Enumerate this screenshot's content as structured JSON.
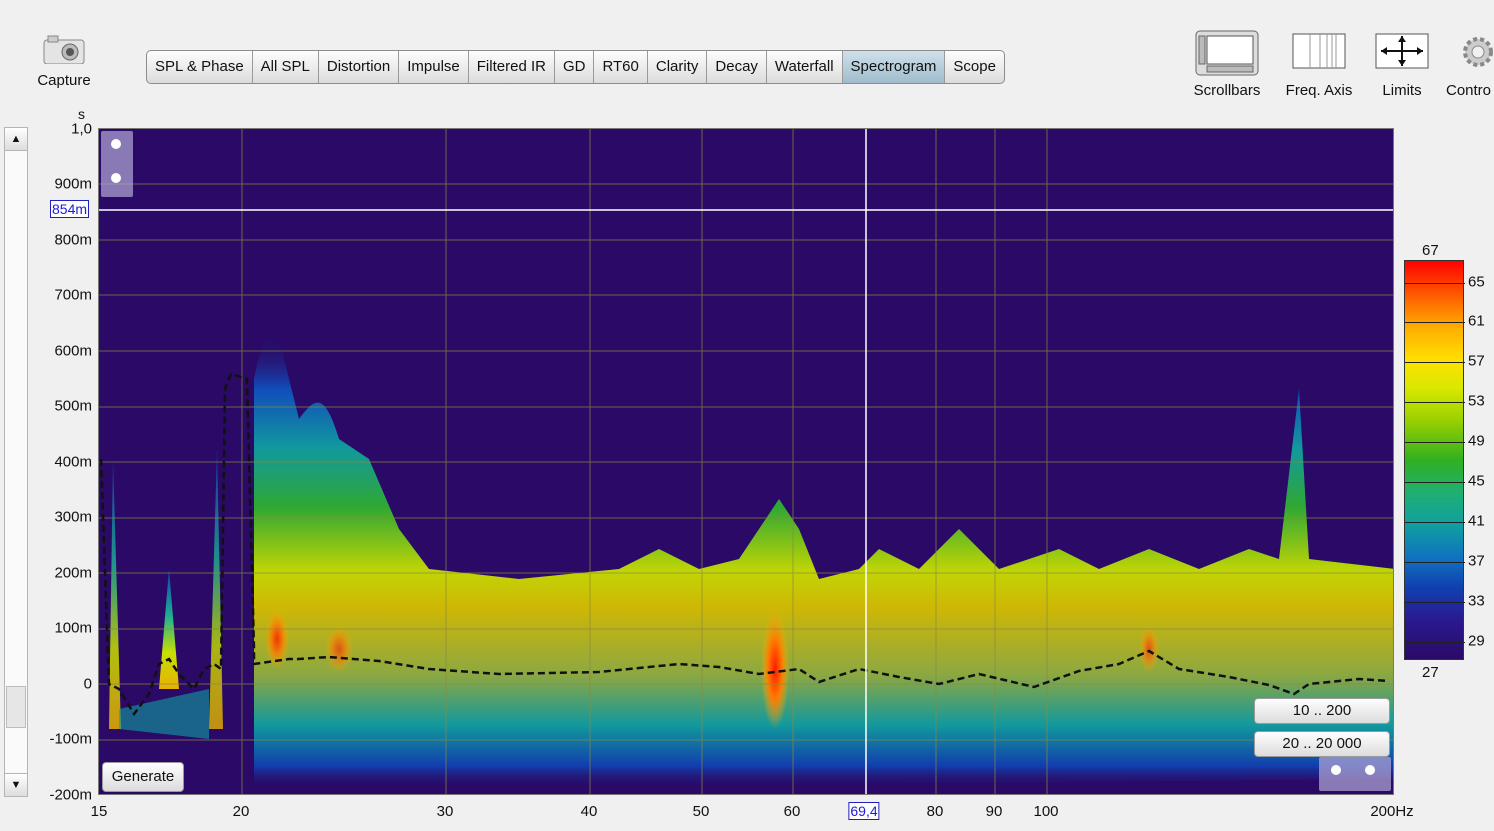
{
  "capture": {
    "label": "Capture"
  },
  "tabs": [
    {
      "label": "SPL & Phase",
      "active": false
    },
    {
      "label": "All SPL",
      "active": false
    },
    {
      "label": "Distortion",
      "active": false
    },
    {
      "label": "Impulse",
      "active": false
    },
    {
      "label": "Filtered IR",
      "active": false
    },
    {
      "label": "GD",
      "active": false
    },
    {
      "label": "RT60",
      "active": false
    },
    {
      "label": "Clarity",
      "active": false
    },
    {
      "label": "Decay",
      "active": false
    },
    {
      "label": "Waterfall",
      "active": false
    },
    {
      "label": "Spectrogram",
      "active": true
    },
    {
      "label": "Scope",
      "active": false
    }
  ],
  "toolbar": {
    "scrollbars": "Scrollbars",
    "freq_axis": "Freq. Axis",
    "limits": "Limits",
    "controls": "Contro"
  },
  "y_axis": {
    "unit": "s",
    "ticks": [
      "1,0",
      "900m",
      "800m",
      "700m",
      "600m",
      "500m",
      "400m",
      "300m",
      "200m",
      "100m",
      "0",
      "-100m",
      "-200m"
    ],
    "cursor_label": "854m"
  },
  "x_axis": {
    "ticks": [
      "15",
      "20",
      "30",
      "40",
      "50",
      "60",
      "80",
      "90",
      "100",
      "200Hz"
    ],
    "cursor_label": "69,4"
  },
  "buttons": {
    "generate": "Generate",
    "range_low": "10 .. 200",
    "range_full": "20 .. 20 000"
  },
  "color_scale": {
    "max": "67",
    "min": "27",
    "ticks": [
      "65",
      "61",
      "57",
      "53",
      "49",
      "45",
      "41",
      "37",
      "33",
      "29"
    ]
  },
  "colors": {
    "plot_background": "#2a0a66",
    "active_tab": "#a9c3d2",
    "cursor": "#ffffff"
  }
}
